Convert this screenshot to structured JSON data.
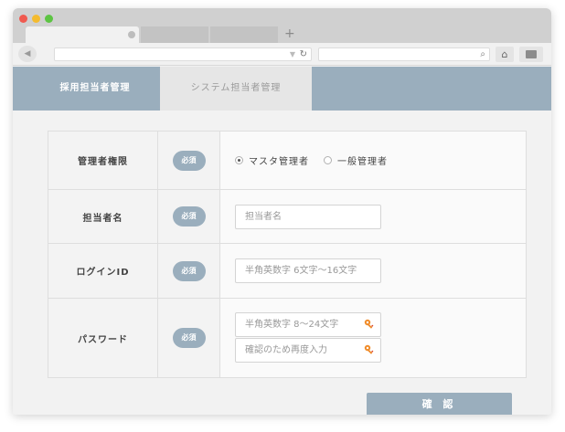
{
  "browser": {
    "new_tab_label": "+",
    "reload_glyph": "↻",
    "search_glyph": "⌕",
    "home_glyph": "⌂",
    "back_glyph": "◀",
    "url_arrow_glyph": "▼"
  },
  "nav": {
    "tabs": [
      {
        "label": "採用担当者管理",
        "active": true
      },
      {
        "label": "システム担当者管理",
        "active": false
      }
    ]
  },
  "form": {
    "required_label": "必須",
    "rows": [
      {
        "label": "管理者権限",
        "type": "radio",
        "options": [
          {
            "label": "マスタ管理者",
            "checked": true
          },
          {
            "label": "一般管理者",
            "checked": false
          }
        ]
      },
      {
        "label": "担当者名",
        "type": "text",
        "placeholder": "担当者名"
      },
      {
        "label": "ログインID",
        "type": "text",
        "placeholder": "半角英数字 6文字～16文字"
      },
      {
        "label": "パスワード",
        "type": "password",
        "placeholder": "半角英数字 8～24文字",
        "confirm_placeholder": "確認のため再度入力"
      }
    ]
  },
  "actions": {
    "confirm_label": "確 認"
  },
  "colors": {
    "accent": "#9aaebd",
    "key_icon": "#f08c2a"
  }
}
